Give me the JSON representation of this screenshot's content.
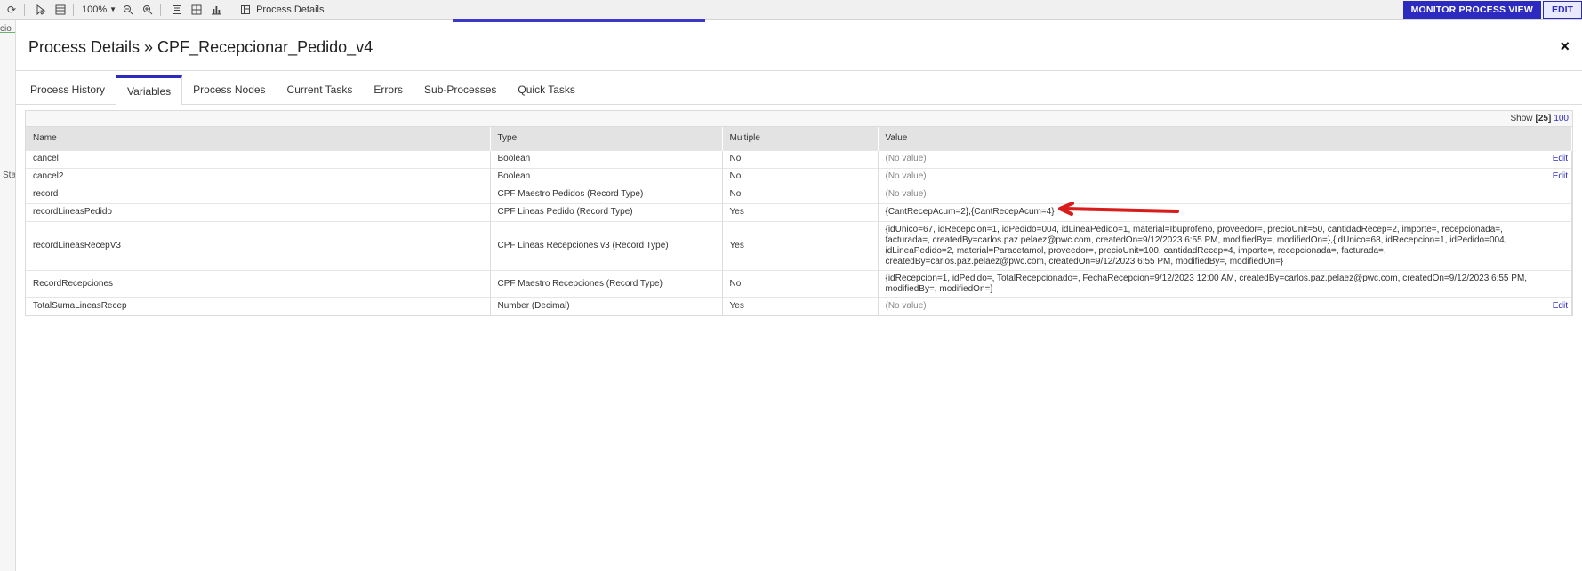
{
  "toolbar": {
    "zoom_value": "100%",
    "title": "Process Details",
    "monitor_button": "MONITOR PROCESS VIEW",
    "edit_button": "EDIT"
  },
  "background": {
    "left_text_1": "cio",
    "left_text_2": "Sta"
  },
  "dialog": {
    "title": "Process Details » CPF_Recepcionar_Pedido_v4",
    "close_label": "×"
  },
  "tabs": [
    {
      "label": "Process History"
    },
    {
      "label": "Variables"
    },
    {
      "label": "Process Nodes"
    },
    {
      "label": "Current Tasks"
    },
    {
      "label": "Errors"
    },
    {
      "label": "Sub-Processes"
    },
    {
      "label": "Quick Tasks"
    }
  ],
  "active_tab": "Variables",
  "pagination": {
    "show_label": "Show",
    "current": "[25]",
    "option": "100"
  },
  "table": {
    "headers": [
      "Name",
      "Type",
      "Multiple",
      "Value"
    ],
    "rows": [
      {
        "name": "cancel",
        "type": "Boolean",
        "multiple": "No",
        "value": "(No value)",
        "action": "Edit"
      },
      {
        "name": "cancel2",
        "type": "Boolean",
        "multiple": "No",
        "value": "(No value)",
        "action": "Edit"
      },
      {
        "name": "record",
        "type": "CPF Maestro Pedidos (Record Type)",
        "multiple": "No",
        "value": "(No value)",
        "action": ""
      },
      {
        "name": "recordLineasPedido",
        "type": "CPF Lineas Pedido (Record Type)",
        "multiple": "Yes",
        "value": "{CantRecepAcum=2},{CantRecepAcum=4}",
        "action": ""
      },
      {
        "name": "recordLineasRecepV3",
        "type": "CPF Lineas Recepciones v3 (Record Type)",
        "multiple": "Yes",
        "value": "{idUnico=67, idRecepcion=1, idPedido=004, idLineaPedido=1, material=Ibuprofeno, proveedor=, precioUnit=50, cantidadRecep=2, importe=, recepcionada=, facturada=, createdBy=carlos.paz.pelaez@pwc.com, createdOn=9/12/2023 6:55 PM, modifiedBy=, modifiedOn=},{idUnico=68, idRecepcion=1, idPedido=004, idLineaPedido=2, material=Paracetamol, proveedor=, precioUnit=100, cantidadRecep=4, importe=, recepcionada=, facturada=, createdBy=carlos.paz.pelaez@pwc.com, createdOn=9/12/2023 6:55 PM, modifiedBy=, modifiedOn=}",
        "action": ""
      },
      {
        "name": "RecordRecepciones",
        "type": "CPF Maestro Recepciones (Record Type)",
        "multiple": "No",
        "value": "{idRecepcion=1, idPedido=, TotalRecepcionado=, FechaRecepcion=9/12/2023 12:00 AM, createdBy=carlos.paz.pelaez@pwc.com, createdOn=9/12/2023 6:55 PM, modifiedBy=, modifiedOn=}",
        "action": ""
      },
      {
        "name": "TotalSumaLineasRecep",
        "type": "Number (Decimal)",
        "multiple": "Yes",
        "value": "(No value)",
        "action": "Edit"
      }
    ]
  },
  "colors": {
    "accent": "#2d2ac0",
    "annotation": "#d81b1b"
  }
}
